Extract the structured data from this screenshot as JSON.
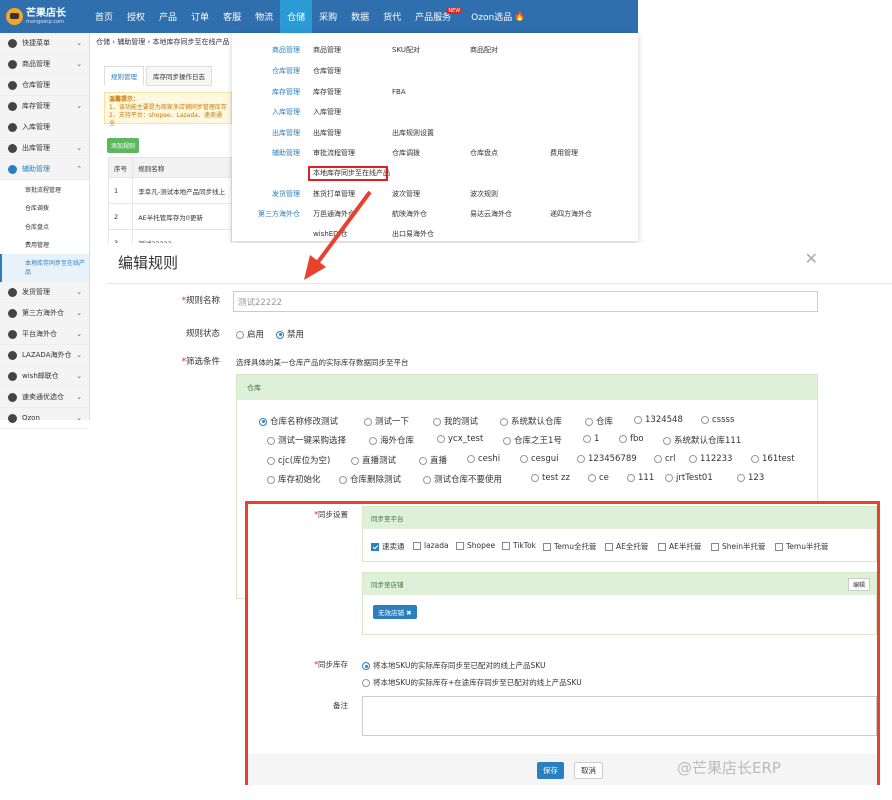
{
  "brand": {
    "name": "芒果店长",
    "sub": "mangoerp.com"
  },
  "nav": {
    "items": [
      "首页",
      "授权",
      "产品",
      "订单",
      "客服",
      "物流",
      "仓储",
      "采购",
      "数据",
      "货代",
      "产品服务",
      "Ozon选品"
    ],
    "new_badge": "NEW"
  },
  "sidebar": {
    "items": [
      "快捷菜单",
      "商品管理",
      "仓库管理",
      "库存管理",
      "入库管理",
      "出库管理",
      "辅助管理"
    ],
    "sub_items": [
      "审批流程管理",
      "仓库调拨",
      "仓库盘点",
      "费用管理",
      "本地库存同步至在线产品"
    ],
    "items_bottom": [
      "发货管理",
      "第三方海外仓",
      "平台海外仓",
      "LAZADA海外仓",
      "wish邮联仓",
      "速卖通优选仓",
      "Ozon"
    ]
  },
  "breadcrumb": "仓储 › 辅助管理 › 本地库存同步至在线产品",
  "tabs": [
    "规则管理",
    "库存同步操作日志"
  ],
  "tip": {
    "title": "温馨提示：",
    "line1": "1、该功能主要是为商家多店铺同步管理库存",
    "line2": "2、支持平台：shopee、Lazada、速卖通全"
  },
  "add_rule_btn": "添加规则",
  "table": {
    "headers": [
      "序号",
      "规则名称"
    ],
    "rows": [
      [
        "1",
        "李幸凡-测试本地产品同步线上"
      ],
      [
        "2",
        "AE半托管库存为0更新"
      ],
      [
        "3",
        "测试22222"
      ]
    ]
  },
  "mega_menu": {
    "rows": [
      {
        "cat": "商品管理",
        "links": [
          "商品管理",
          "SKU配对",
          "商品配对"
        ]
      },
      {
        "cat": "仓库管理",
        "links": [
          "仓库管理"
        ]
      },
      {
        "cat": "库存管理",
        "links": [
          "库存管理",
          "FBA"
        ]
      },
      {
        "cat": "入库管理",
        "links": [
          "入库管理"
        ]
      },
      {
        "cat": "出库管理",
        "links": [
          "出库管理",
          "出库规则设置"
        ]
      },
      {
        "cat": "辅助管理",
        "links": [
          "审批流程管理",
          "仓库调拨",
          "仓库盘点",
          "费用管理"
        ]
      },
      {
        "cat": "",
        "links": [
          "本地库存同步至在线产品"
        ]
      },
      {
        "cat": "发货管理",
        "links": [
          "拣货打单管理",
          "波次管理",
          "波次规则"
        ]
      },
      {
        "cat": "第三方海外仓",
        "links": [
          "万邑通海外仓",
          "航映海外仓",
          "易达云海外仓",
          "递四方海外仓"
        ]
      },
      {
        "cat": "",
        "links": [
          "wishEDI仓",
          "出口易海外仓"
        ]
      }
    ]
  },
  "modal": {
    "title": "编辑规则",
    "close": "✕",
    "name_label": "规则名称",
    "name_value": "测试22222",
    "status_label": "规则状态",
    "status_options": [
      "启用",
      "禁用"
    ],
    "status_selected": "禁用",
    "filter_label": "筛选条件",
    "filter_desc": "选择具体的某一仓库产品的实际库存数据同步至平台",
    "warehouse_head": "仓库",
    "warehouses": [
      [
        "仓库名称修改测试",
        "测试一下",
        "我的测试",
        "系统默认仓库",
        "仓库",
        "1324548",
        "cssss"
      ],
      [
        "测试一键采购选择",
        "海外仓库",
        "ycx_test",
        "仓库之王1号",
        "1",
        "fbo",
        "系统默认仓库111"
      ],
      [
        "cjc(库位为空)",
        "直播测试",
        "直播",
        "ceshi",
        "cesgui",
        "123456789",
        "crl",
        "112233",
        "161test"
      ],
      [
        "库存初始化",
        "仓库删除测试",
        "测试仓库不要使用",
        "test zz",
        "ce",
        "111",
        "jrtTest01",
        "123"
      ]
    ],
    "warehouse_selected": "仓库名称修改测试",
    "sync_label": "同步设置",
    "sync_platform_head": "同步至平台",
    "platforms": [
      "速卖通",
      "lazada",
      "Shopee",
      "TikTok",
      "Temu全托管",
      "AE全托管",
      "AE半托管",
      "Shein半托管",
      "Temu半托管"
    ],
    "platform_checked": "速卖通",
    "sync_store_head": "同步至店铺",
    "edit_btn": "编辑",
    "store_tag": "无效店铺",
    "stock_label": "同步库存",
    "stock_options": [
      "将本地SKU的实际库存同步至已配对的线上产品SKU",
      "将本地SKU的实际库存+在途库存同步至已配对的线上产品SKU"
    ],
    "remark_label": "备注",
    "save": "保存",
    "cancel": "取消"
  },
  "watermark": "@芒果店长ERP",
  "colors": {
    "nav_bg": "#2f6fad",
    "nav_active": "#2a9bd4",
    "accent": "#2a7fc0",
    "highlight_red": "#e8412d",
    "panel_head": "#dff0d8"
  }
}
